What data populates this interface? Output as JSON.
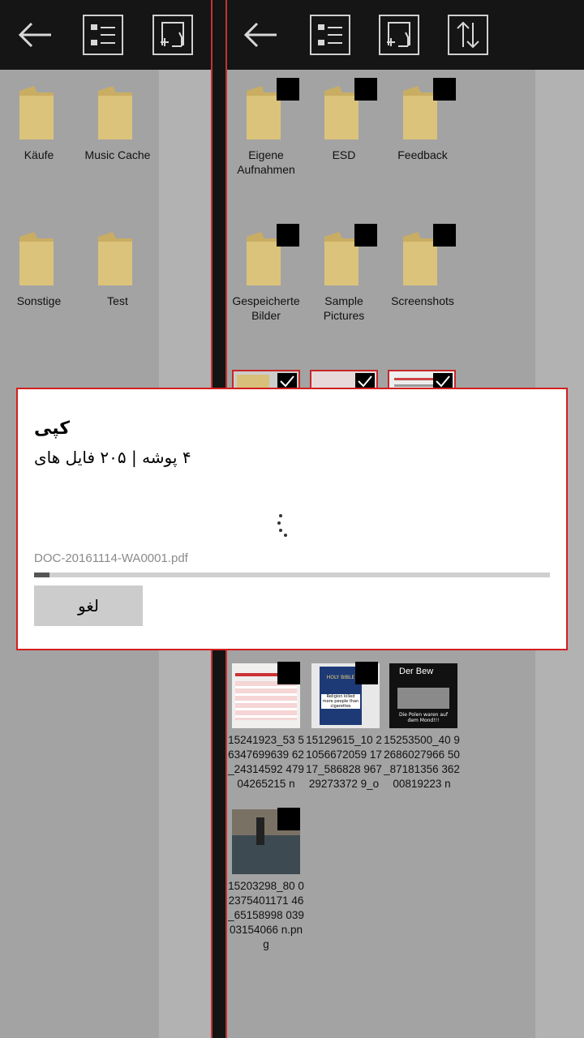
{
  "left_pane": {
    "folders": [
      {
        "label": "Käufe"
      },
      {
        "label": "Music Cache"
      },
      {
        "label": "Sonstige"
      },
      {
        "label": "Test"
      }
    ]
  },
  "right_pane": {
    "folders": [
      {
        "label": "Eigene Aufnahmen"
      },
      {
        "label": "ESD"
      },
      {
        "label": "Feedback"
      },
      {
        "label": "Gespeicherte Bilder"
      },
      {
        "label": "Sample Pictures"
      },
      {
        "label": "Screenshots"
      }
    ],
    "images": [
      {
        "label": "15241923_53 56347699639 62_24314592 47904265215 n",
        "caption": ""
      },
      {
        "label": "15129615_10 21056672059 1717_586828 96729273372 9_o",
        "caption": "Religion killed more people than cigarettes"
      },
      {
        "label": "15253500_40 92686027966 50_87181356 36200819223 n",
        "caption": "Der Bew"
      },
      {
        "label": "15203298_80 02375401171 46_65158998 03903154066 n.png",
        "caption": ""
      }
    ],
    "image_overlay_text": {
      "bible": "HOLY BIBLE",
      "moon": "Die Polen waren auf dem Mond!!!"
    }
  },
  "dialog": {
    "title": "کپی",
    "subtitle": "۴ پوشه | ۲۰۵ فایل های",
    "file_name": "DOC-20161114-WA0001.pdf",
    "progress_fraction": 0.03,
    "cancel_label": "لغو"
  },
  "colors": {
    "accent_red": "#d21f1f",
    "folder_yellow": "#d8c07a",
    "pane_bg": "#a3a3a3"
  }
}
